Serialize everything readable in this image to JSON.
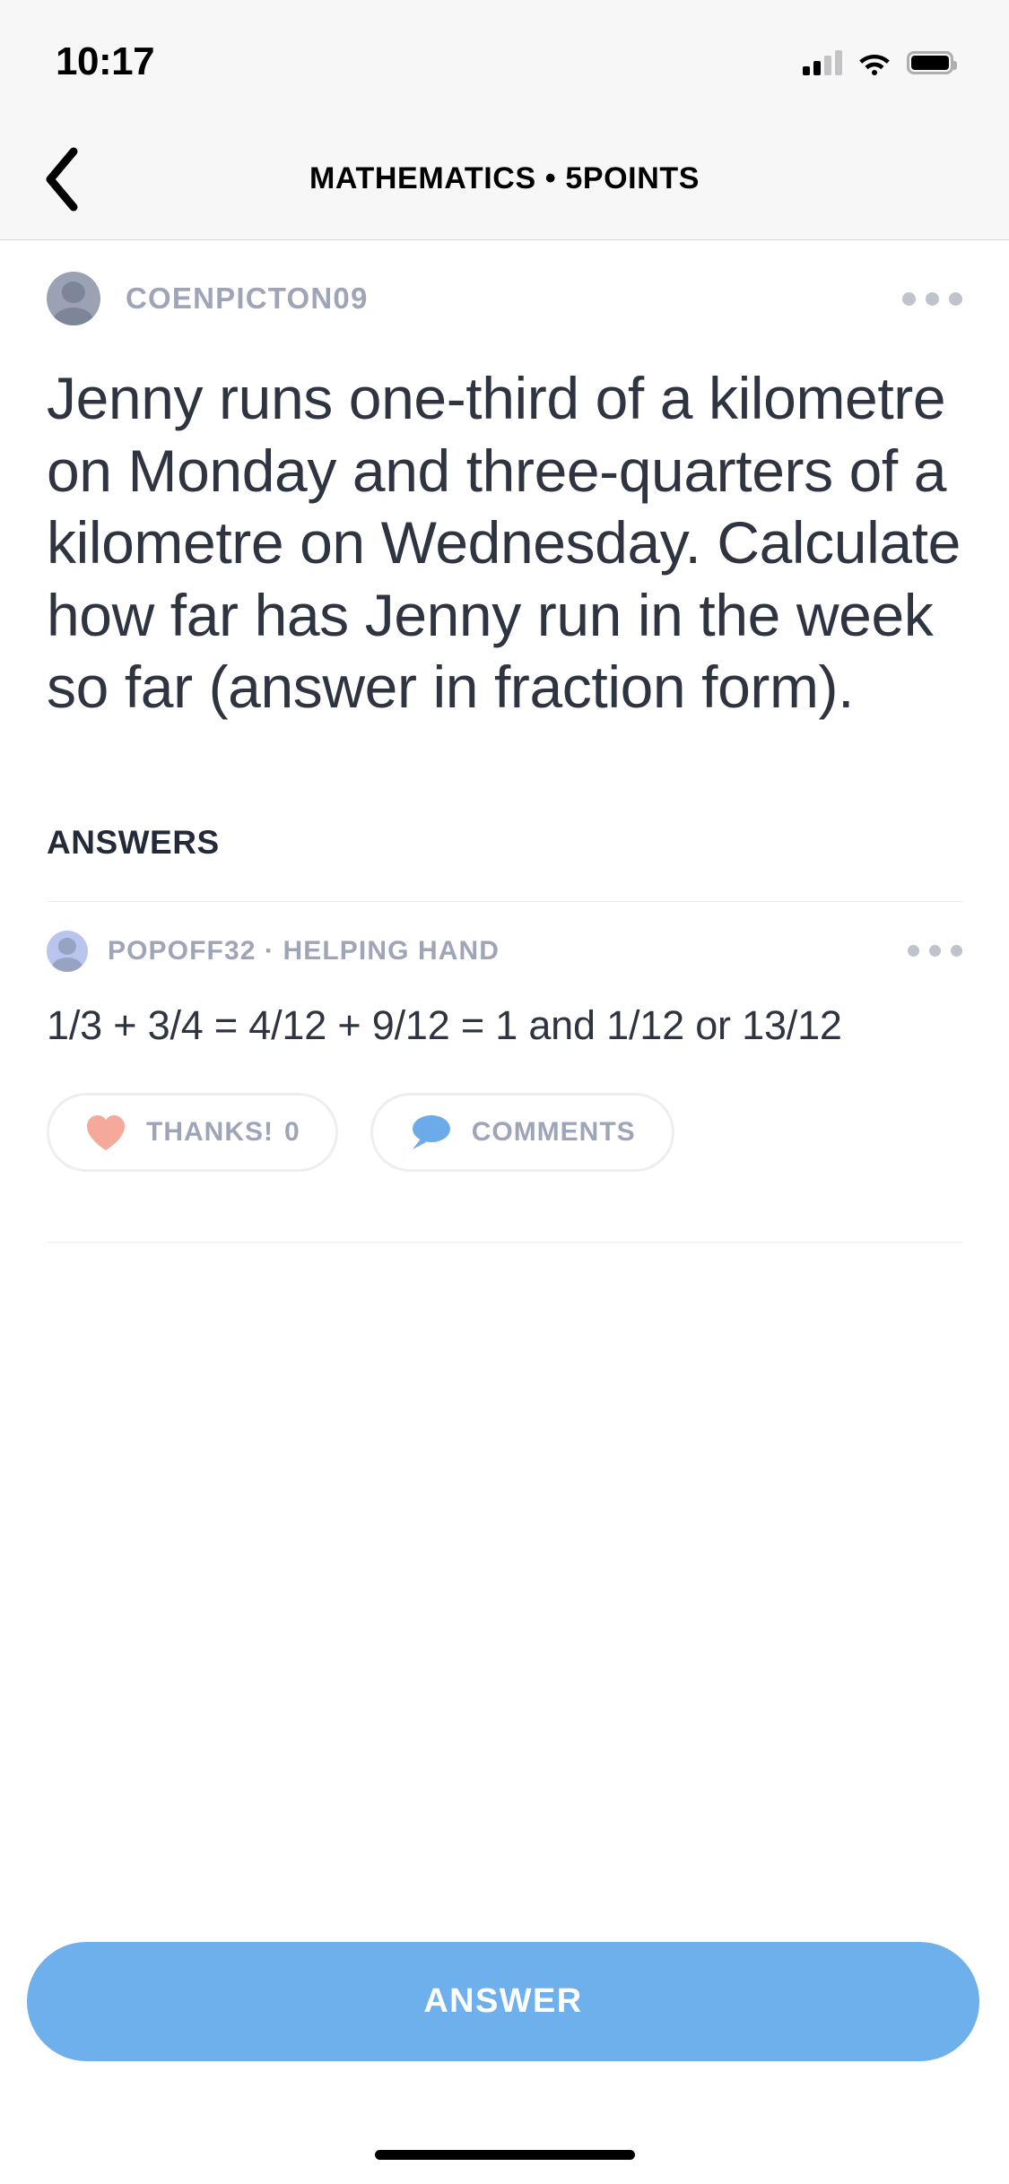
{
  "status_bar": {
    "time": "10:17",
    "signal_icon": "cellular-signal-icon",
    "wifi_icon": "wifi-icon",
    "battery_icon": "battery-full-icon"
  },
  "navbar": {
    "back_icon": "chevron-left-icon",
    "title": "MATHEMATICS • 5POINTS"
  },
  "question": {
    "author": "COENPICTON09",
    "avatar_icon": "user-avatar-icon",
    "overflow_icon": "more-options-icon",
    "text": "Jenny runs one-third of a kilometre on Monday and three-quarters of a kilometre on Wednesday. Calculate how far has Jenny run in the week so far (answer in fraction form)."
  },
  "answers_section": {
    "heading": "ANSWERS",
    "items": [
      {
        "author": "POPOFF32 · HELPING HAND",
        "avatar_icon": "user-avatar-icon",
        "overflow_icon": "more-options-icon",
        "text": "1/3 + 3/4 = 4/12 + 9/12 = 1 and 1/12 or 13/12",
        "thanks_icon": "heart-icon",
        "thanks_label": "THANKS!",
        "thanks_count": "0",
        "comments_icon": "speech-bubble-icon",
        "comments_label": "COMMENTS"
      }
    ]
  },
  "footer": {
    "answer_button_label": "ANSWER"
  },
  "colors": {
    "accent_blue": "#6eb0ec",
    "heart_pink": "#f5a99a",
    "bubble_blue": "#6cabe9",
    "username_gray": "#9ea5b8",
    "text_dark": "#2e3440",
    "avatar_gray": "#9ba2b3",
    "avatar_lavender": "#b9c5ef"
  }
}
